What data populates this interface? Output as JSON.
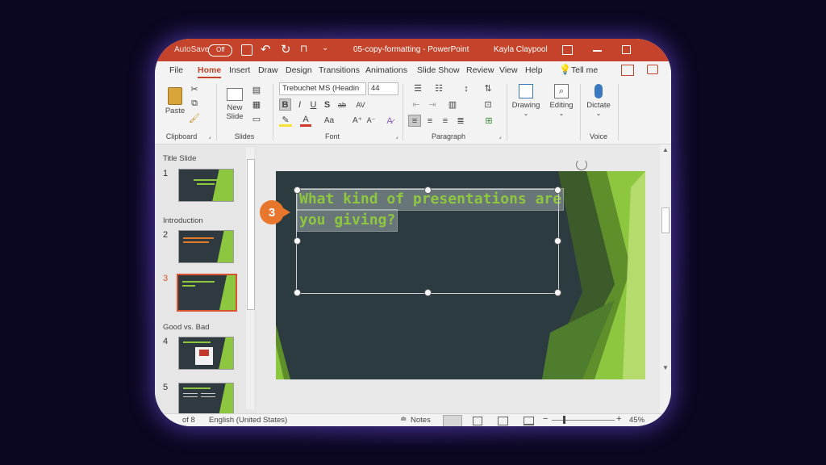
{
  "titlebar": {
    "autosave_label": "AutoSave",
    "autosave_state": "Off",
    "document_title": "05-copy-formatting - PowerPoint",
    "user_name": "Kayla Claypool"
  },
  "tabs": [
    "File",
    "Home",
    "Insert",
    "Draw",
    "Design",
    "Transitions",
    "Animations",
    "Slide Show",
    "Review",
    "View",
    "Help"
  ],
  "tell_me": "Tell me",
  "ribbon": {
    "clipboard": {
      "paste_label": "Paste",
      "group_label": "Clipboard"
    },
    "slides": {
      "new_slide_label": "New Slide",
      "group_label": "Slides"
    },
    "font": {
      "font_name": "Trebuchet MS (Headin",
      "font_size": "44",
      "group_label": "Font"
    },
    "paragraph": {
      "group_label": "Paragraph"
    },
    "drawing_label": "Drawing",
    "editing_label": "Editing",
    "dictate_label": "Dictate",
    "voice_group_label": "Voice"
  },
  "slide_panel": {
    "sections": [
      "Title Slide",
      "Introduction",
      "Good vs. Bad"
    ],
    "slide_numbers": [
      "1",
      "2",
      "3",
      "4",
      "5"
    ],
    "selected_slide": "3"
  },
  "slide": {
    "title_line1": "What kind of presentations are",
    "title_line2": "you giving?"
  },
  "callout": {
    "number": "3"
  },
  "statusbar": {
    "slide_info": "of 8",
    "language": "English (United States)",
    "notes_label": "Notes",
    "zoom": "45%"
  },
  "colors": {
    "titlebar": "#c4432a",
    "accent_green": "#8dc63f",
    "slide_dark": "#2c3b40",
    "callout_orange": "#e8762c",
    "selection_red": "#d9542e"
  }
}
